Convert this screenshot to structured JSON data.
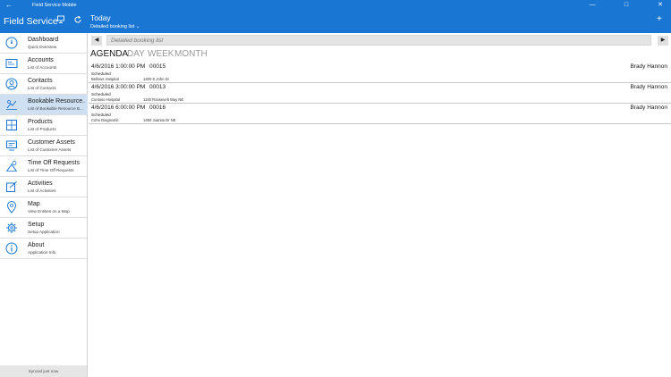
{
  "window": {
    "title": "Field Service Mobile",
    "back_icon": "back-arrow-icon",
    "minimize_icon": "minimize-icon",
    "maximize_icon": "maximize-icon",
    "close_icon": "close-icon"
  },
  "header": {
    "app_name": "Field Service",
    "title": "Today",
    "subtitle": "Detailed booking list",
    "accent": "#1976d2"
  },
  "sidebar": {
    "items": [
      {
        "label": "Dashboard",
        "sub": "Quick Overview",
        "icon": "dashboard-icon"
      },
      {
        "label": "Accounts",
        "sub": "List of Accounts",
        "icon": "accounts-icon"
      },
      {
        "label": "Contacts",
        "sub": "List of Contacts",
        "icon": "contacts-icon"
      },
      {
        "label": "Bookable Resource...",
        "sub": "List of Bookable Resource B...",
        "icon": "bookable-resource-icon"
      },
      {
        "label": "Products",
        "sub": "List of Products",
        "icon": "products-icon"
      },
      {
        "label": "Customer Assets",
        "sub": "List of Customer Assets",
        "icon": "customer-assets-icon"
      },
      {
        "label": "Time Off Requests",
        "sub": "List of Time Off Requests",
        "icon": "time-off-icon"
      },
      {
        "label": "Activities",
        "sub": "List of Activities",
        "icon": "activities-icon"
      },
      {
        "label": "Map",
        "sub": "View Entities on a Map",
        "icon": "map-pin-icon"
      },
      {
        "label": "Setup",
        "sub": "Setup Application",
        "icon": "setup-gear-icon"
      },
      {
        "label": "About",
        "sub": "Application Info",
        "icon": "info-icon"
      }
    ],
    "synced": "Synced just now"
  },
  "main": {
    "search_placeholder": "Detailed booking list",
    "tabs": [
      "AGENDA",
      "DAY",
      "WEEK",
      "MONTH"
    ],
    "active_tab": "AGENDA",
    "bookings": [
      {
        "datetime": "4/6/2016 1:00:00 PM",
        "number": "00015",
        "status": "Scheduled",
        "account": "Bellows Hospital",
        "address": "1400 E John St",
        "resource": "Brady Hannon"
      },
      {
        "datetime": "4/6/2016 3:00:00 PM",
        "number": "00013",
        "status": "Scheduled",
        "account": "Contoso Hospital",
        "address": "1100 Roosevelt Way NE",
        "resource": "Brady Hannon"
      },
      {
        "datetime": "4/6/2016 6:00:00 PM",
        "number": "00016",
        "status": "Scheduled",
        "account": "Coho Diagnostic",
        "address": "1450 Juanita Dr NE",
        "resource": "Brady Hannon"
      }
    ]
  }
}
